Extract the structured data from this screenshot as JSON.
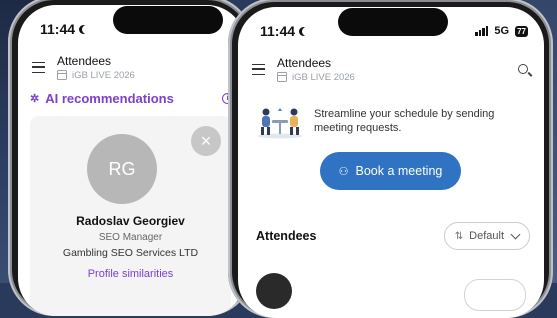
{
  "left_phone": {
    "status": {
      "time": "11:44"
    },
    "appbar": {
      "title": "Attendees",
      "event": "iGB LIVE 2026"
    },
    "ai": {
      "label": "AI recommendations"
    },
    "card": {
      "initials": "RG",
      "name": "Radoslav Georgiev",
      "role": "SEO Manager",
      "company": "Gambling SEO Services LTD",
      "link": "Profile similarities"
    }
  },
  "right_phone": {
    "status": {
      "time": "11:44",
      "network": "5G",
      "battery": "77"
    },
    "appbar": {
      "title": "Attendees",
      "event": "iGB LIVE 2026"
    },
    "promo": {
      "text_line1": "Streamline your schedule by sending",
      "text_line2": "meeting requests."
    },
    "book_button": {
      "label": "Book a meeting"
    },
    "section": {
      "title": "Attendees"
    },
    "sort": {
      "label": "Default"
    }
  },
  "colors": {
    "accent_purple": "#7b3fd1",
    "primary_blue": "#2f73c2",
    "avatar_grey": "#b7b7b7"
  }
}
